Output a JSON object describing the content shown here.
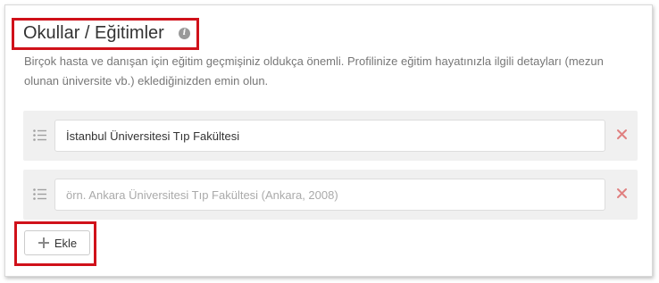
{
  "section": {
    "title": "Okullar / Eğitimler",
    "info_icon": "info-icon",
    "description": "Birçok hasta ve danışan için eğitim geçmişiniz oldukça önemli. Profilinize eğitim hayatınızla ilgili detayları (mezun olunan üniversite vb.) eklediğinizden emin olun."
  },
  "schools": [
    {
      "value": "İstanbul Üniversitesi Tıp Fakültesi",
      "placeholder": ""
    },
    {
      "value": "",
      "placeholder": "örn. Ankara Üniversitesi Tıp Fakültesi (Ankara, 2008)"
    }
  ],
  "add_button": {
    "label": "Ekle",
    "icon": "plus-icon"
  },
  "colors": {
    "highlight": "#d0111a",
    "remove": "#e08080",
    "row_background": "#f0f0f0",
    "muted_text": "#777777"
  }
}
